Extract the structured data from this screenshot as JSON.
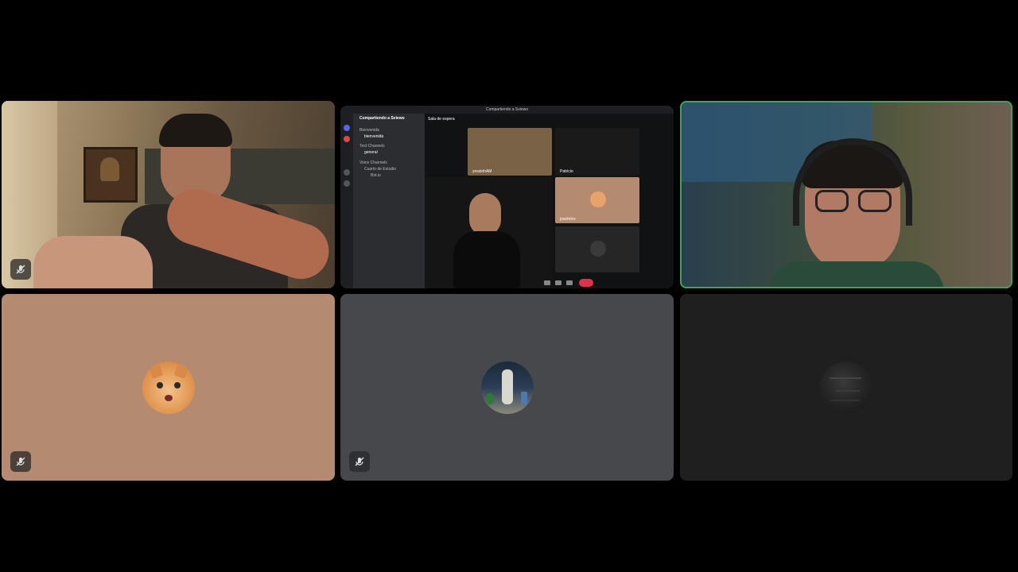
{
  "participants": [
    {
      "id": "p1",
      "muted": true,
      "speaking": false,
      "type": "video",
      "scene": "dim room, man at desk with framed painting on wall"
    },
    {
      "id": "p2",
      "muted": false,
      "speaking": false,
      "type": "screenshare"
    },
    {
      "id": "p3",
      "muted": false,
      "speaking": true,
      "type": "video",
      "scene": "person with headphones and glasses"
    },
    {
      "id": "p4",
      "muted": true,
      "speaking": false,
      "type": "avatar",
      "avatar": "cat-avatar",
      "bg": "#b48b70"
    },
    {
      "id": "p5",
      "muted": true,
      "speaking": false,
      "type": "avatar",
      "avatar": "statue-avatar",
      "bg": "#46484c"
    },
    {
      "id": "p6",
      "muted": false,
      "speaking": false,
      "type": "avatar",
      "avatar": "dark-texture-avatar",
      "bg": "#1f1f1f"
    }
  ],
  "screenshare": {
    "window_title": "Compartiendo a Sviewo",
    "server_name": "Compartiendo a Sviewo",
    "voice_header": "Sala de espera",
    "categories": [
      "Bienvenida",
      "Text Channels",
      "Voice Channels"
    ],
    "channels": [
      "bienvenida",
      "general",
      "Cuarto de Estudio",
      "Bot.io"
    ],
    "labels": [
      "yessinhAM",
      "Patricio",
      "josefelox"
    ]
  },
  "colors": {
    "speaking_border": "#3ba55d",
    "end_call": "#e0314b"
  }
}
